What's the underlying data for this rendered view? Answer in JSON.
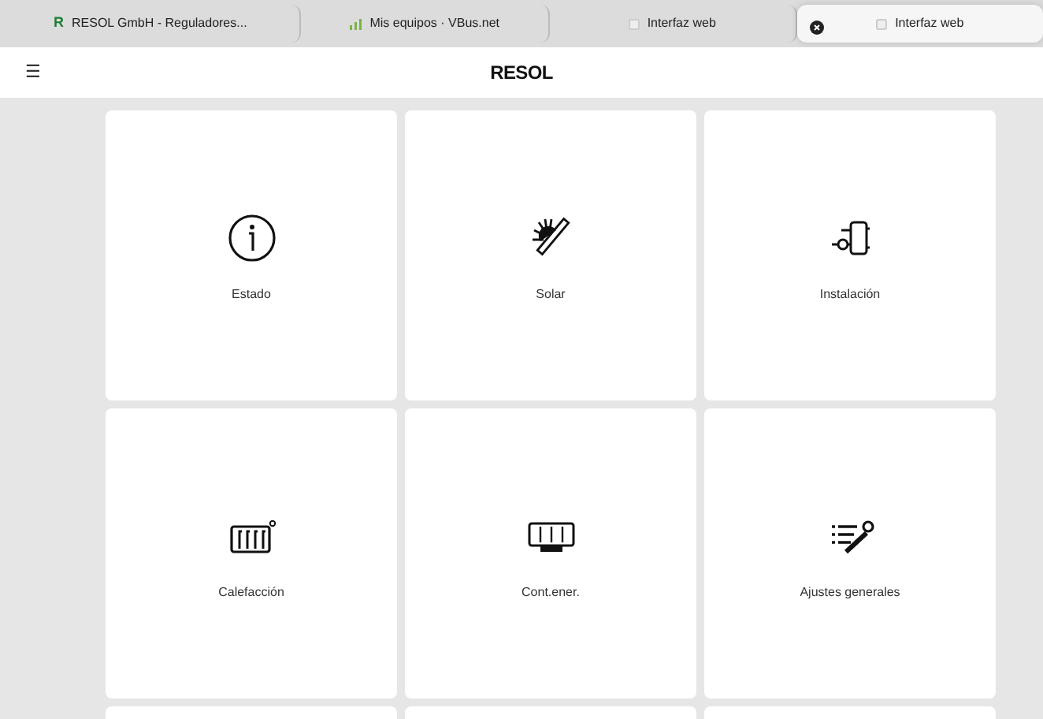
{
  "browser_tabs": [
    {
      "title": "RESOL GmbH - Reguladores...",
      "kind": "letter",
      "favicon_text": "R",
      "selected": false
    },
    {
      "title": "Mis equipos · VBus.net",
      "kind": "bars",
      "selected": false
    },
    {
      "title": "Interfaz web",
      "kind": "page",
      "selected": false
    },
    {
      "title": "Interfaz web",
      "kind": "page",
      "selected": true
    }
  ],
  "header": {
    "logo": "RESOL",
    "menu_icon": "☰"
  },
  "tiles": [
    {
      "label": "Estado",
      "kind": "info"
    },
    {
      "label": "Solar",
      "kind": "solar"
    },
    {
      "label": "Instalación",
      "kind": "system"
    },
    {
      "label": "Calefacción",
      "kind": "radiator"
    },
    {
      "label": "Cont.ener.",
      "kind": "meter"
    },
    {
      "label": "Ajustes generales",
      "kind": "settings"
    }
  ]
}
